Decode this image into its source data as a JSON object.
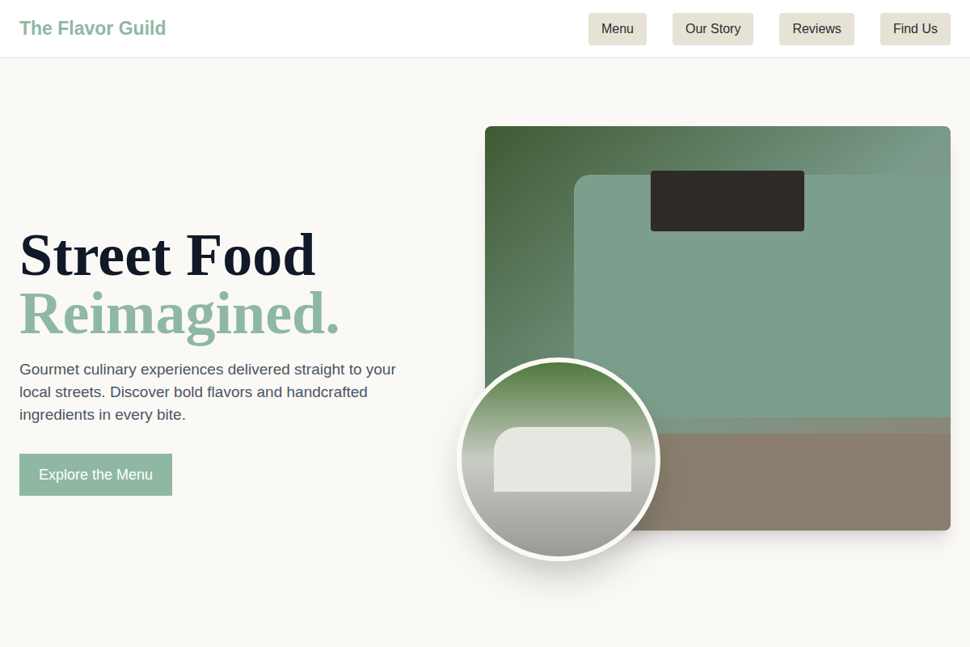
{
  "header": {
    "logo": "The Flavor Guild",
    "nav": [
      {
        "label": "Menu"
      },
      {
        "label": "Our Story"
      },
      {
        "label": "Reviews"
      },
      {
        "label": "Find Us"
      }
    ]
  },
  "hero": {
    "title_line1": "Street Food",
    "title_line2": "Reimagined.",
    "description": "Gourmet culinary experiences delivered straight to your local streets. Discover bold flavors and handcrafted ingredients in every bite.",
    "cta": "Explore the Menu"
  }
}
